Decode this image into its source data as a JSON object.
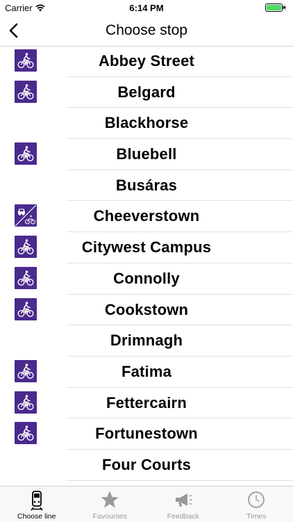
{
  "status_bar": {
    "carrier": "Carrier",
    "time": "6:14 PM"
  },
  "nav": {
    "title": "Choose stop"
  },
  "stops": [
    {
      "name": "Abbey Street",
      "facility": "bike"
    },
    {
      "name": "Belgard",
      "facility": "bike"
    },
    {
      "name": "Blackhorse",
      "facility": "none"
    },
    {
      "name": "Bluebell",
      "facility": "bike"
    },
    {
      "name": "Busáras",
      "facility": "none"
    },
    {
      "name": "Cheeverstown",
      "facility": "car-and-bike"
    },
    {
      "name": "Citywest Campus",
      "facility": "bike"
    },
    {
      "name": "Connolly",
      "facility": "bike"
    },
    {
      "name": "Cookstown",
      "facility": "bike"
    },
    {
      "name": "Drimnagh",
      "facility": "none"
    },
    {
      "name": "Fatima",
      "facility": "bike"
    },
    {
      "name": "Fettercairn",
      "facility": "bike"
    },
    {
      "name": "Fortunestown",
      "facility": "bike"
    },
    {
      "name": "Four Courts",
      "facility": "none"
    }
  ],
  "tabs": [
    {
      "label": "Choose line",
      "icon": "tram-icon",
      "active": true
    },
    {
      "label": "Favourites",
      "icon": "star-icon",
      "active": false
    },
    {
      "label": "Feedback",
      "icon": "megaphone-icon",
      "active": false
    },
    {
      "label": "Times",
      "icon": "clock-icon",
      "active": false
    }
  ],
  "colors": {
    "facility_bg": "#4b2a8e",
    "battery": "#4cd964",
    "tab_inactive": "#9a9a9a"
  }
}
